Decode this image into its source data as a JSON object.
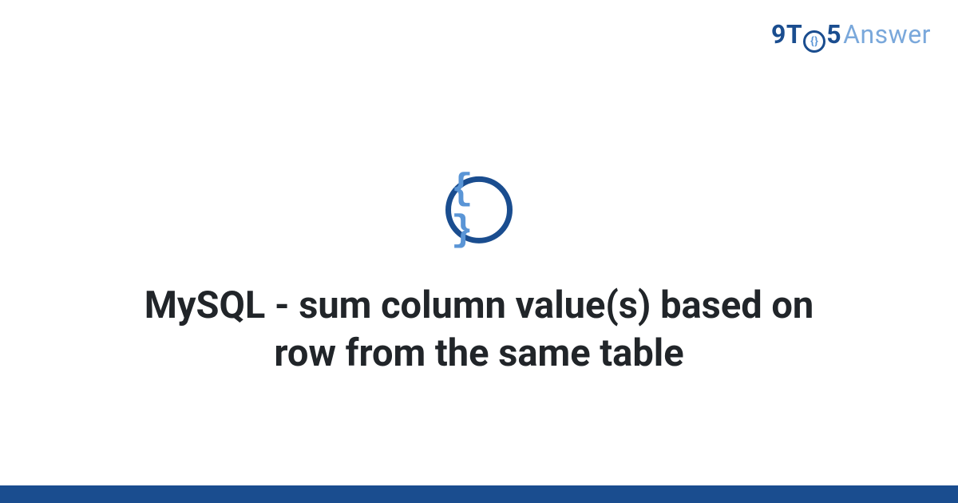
{
  "logo": {
    "part1": "9T",
    "circle": "{}",
    "part2": "5",
    "part3": "Answer"
  },
  "icon": {
    "symbol": "{ }"
  },
  "title": "MySQL - sum column value(s) based on row from the same table"
}
